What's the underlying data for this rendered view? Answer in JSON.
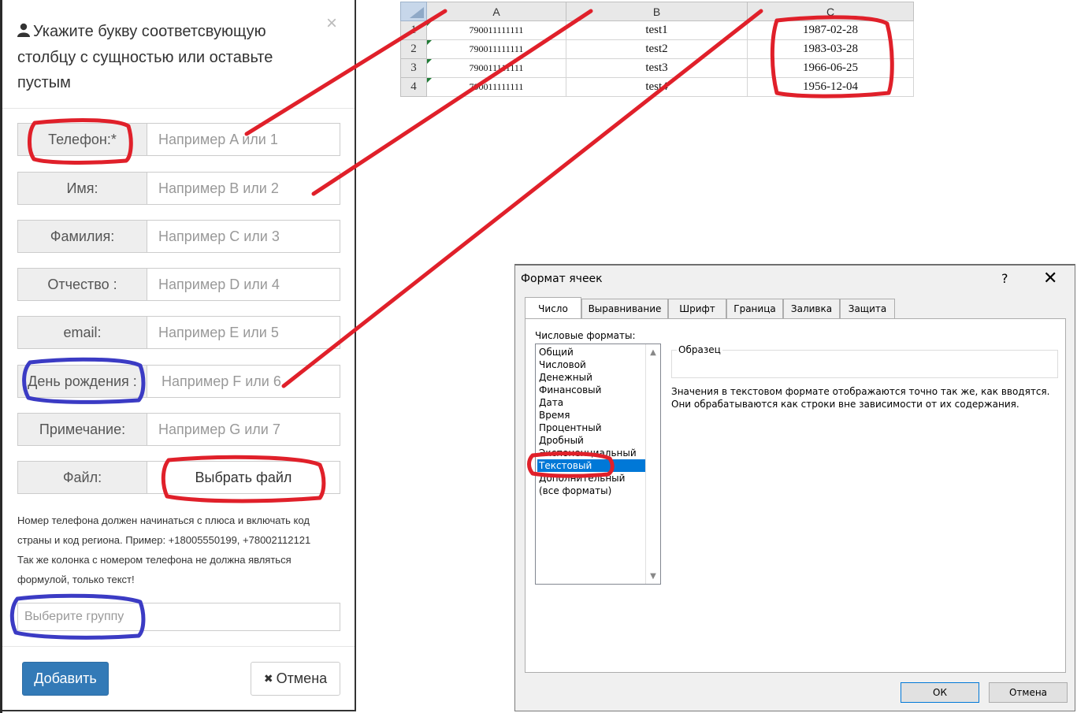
{
  "modal": {
    "title": "Укажите букву соответсвующую столбцу с сущностью или оставьте пустым",
    "close_glyph": "×",
    "fields": [
      {
        "label": "Телефон:*",
        "placeholder": "Например A или 1"
      },
      {
        "label": "Имя:",
        "placeholder": "Например B или 2"
      },
      {
        "label": "Фамилия:",
        "placeholder": "Например C или 3"
      },
      {
        "label": "Отчество :",
        "placeholder": "Например D или 4"
      },
      {
        "label": "email:",
        "placeholder": "Например E или 5"
      },
      {
        "label": "День рождения :",
        "placeholder": "Например F или 6"
      },
      {
        "label": "Примечание:",
        "placeholder": "Например G или 7"
      }
    ],
    "file": {
      "label": "Файл:",
      "button": "Выбрать файл"
    },
    "help_line1": "Номер телефона должен начинаться с плюса и включать код страны и код региона. Пример: +18005550199, +78002112121",
    "help_line2": "Так же колонка с номером телефона не должна являться формулой, только текст!",
    "group_placeholder": "Выберите группу",
    "add_button": "Добавить",
    "cancel_button": "Отмена",
    "cancel_glyph": "✖"
  },
  "sheet": {
    "columns": [
      "A",
      "B",
      "C"
    ],
    "rows": [
      {
        "n": "1",
        "a": "790011111111",
        "b": "test1",
        "c": "1987-02-28"
      },
      {
        "n": "2",
        "a": "790011111111",
        "b": "test2",
        "c": "1983-03-28"
      },
      {
        "n": "3",
        "a": "790011111111",
        "b": "test3",
        "c": "1966-06-25"
      },
      {
        "n": "4",
        "a": "790011111111",
        "b": "test4",
        "c": "1956-12-04"
      }
    ]
  },
  "dialog": {
    "title": "Формат ячеек",
    "help": "?",
    "close": "✕",
    "tabs": [
      "Число",
      "Выравнивание",
      "Шрифт",
      "Граница",
      "Заливка",
      "Защита"
    ],
    "active_tab": "Число",
    "formats_caption": "Числовые форматы:",
    "formats": [
      "Общий",
      "Числовой",
      "Денежный",
      "Финансовый",
      "Дата",
      "Время",
      "Процентный",
      "Дробный",
      "Экспоненциальный",
      "Текстовый",
      "Дополнительный",
      "(все форматы)"
    ],
    "selected_format": "Текстовый",
    "sample_caption": "Образец",
    "description": "Значения в текстовом формате отображаются точно так же, как вводятся. Они обрабатываются как строки вне зависимости от их содержания.",
    "ok": "ОК",
    "cancel": "Отмена"
  },
  "colors": {
    "primary_button": "#337ab7",
    "annotation_red": "#e0202a",
    "annotation_blue": "#3b3bc4",
    "selection_blue": "#0078d7"
  }
}
